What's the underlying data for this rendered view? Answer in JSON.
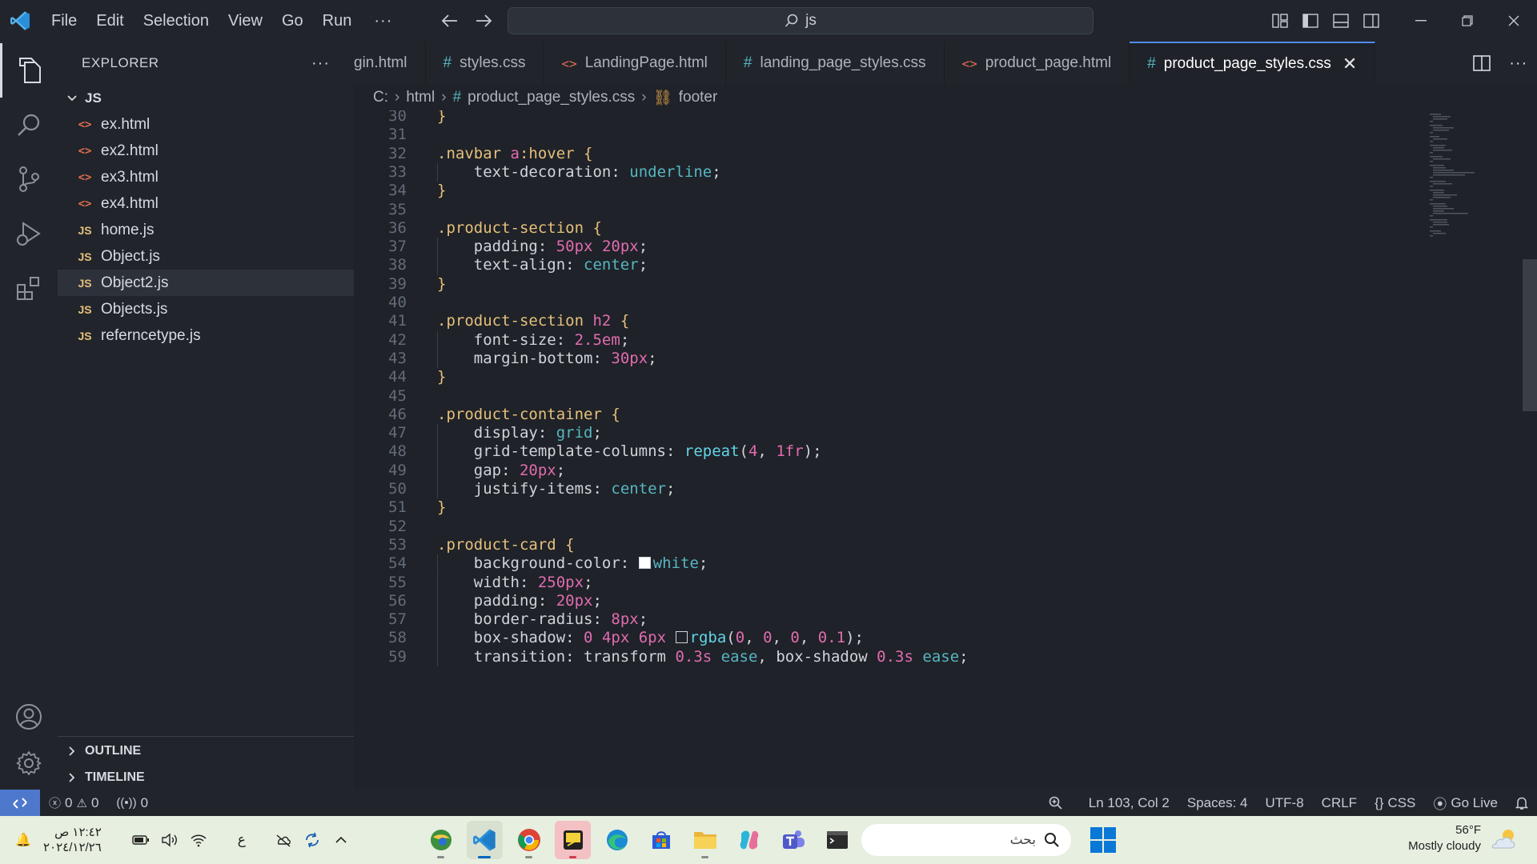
{
  "menu": [
    "File",
    "Edit",
    "Selection",
    "View",
    "Go",
    "Run"
  ],
  "menu_more": "···",
  "command_center": "js",
  "sidebar": {
    "title": "EXPLORER",
    "more": "···",
    "folder": "JS",
    "files": [
      {
        "name": "ex.html",
        "type": "html"
      },
      {
        "name": "ex2.html",
        "type": "html"
      },
      {
        "name": "ex3.html",
        "type": "html"
      },
      {
        "name": "ex4.html",
        "type": "html"
      },
      {
        "name": "home.js",
        "type": "js"
      },
      {
        "name": "Object.js",
        "type": "js"
      },
      {
        "name": "Object2.js",
        "type": "js",
        "selected": true
      },
      {
        "name": "Objects.js",
        "type": "js"
      },
      {
        "name": "referncetype.js",
        "type": "js"
      }
    ],
    "outline": "OUTLINE",
    "timeline": "TIMELINE"
  },
  "tabs": [
    {
      "label": "gin.html",
      "type": "html",
      "icon": ""
    },
    {
      "label": "styles.css",
      "type": "css",
      "icon": "#"
    },
    {
      "label": "LandingPage.html",
      "type": "html",
      "icon": "<>"
    },
    {
      "label": "landing_page_styles.css",
      "type": "css",
      "icon": "#"
    },
    {
      "label": "product_page.html",
      "type": "html",
      "icon": "<>"
    },
    {
      "label": "product_page_styles.css",
      "type": "css",
      "icon": "#",
      "active": true
    }
  ],
  "breadcrumb": {
    "drive": "C:",
    "folder": "html",
    "file": "product_page_styles.css",
    "symbol": "footer"
  },
  "code_lines": [
    {
      "n": "30",
      "tokens": [
        [
          "brace",
          "}"
        ]
      ]
    },
    {
      "n": "31",
      "tokens": []
    },
    {
      "n": "32",
      "tokens": [
        [
          "sel",
          ".navbar "
        ],
        [
          "el",
          "a"
        ],
        [
          "sel",
          ":hover "
        ],
        [
          "brace",
          "{"
        ]
      ]
    },
    {
      "n": "33",
      "tokens": [
        [
          "ind",
          ""
        ],
        [
          "prop",
          "text-decoration"
        ],
        [
          "pun",
          ": "
        ],
        [
          "val",
          "underline"
        ],
        [
          "pun",
          ";"
        ]
      ]
    },
    {
      "n": "34",
      "tokens": [
        [
          "brace",
          "}"
        ]
      ]
    },
    {
      "n": "35",
      "tokens": []
    },
    {
      "n": "36",
      "tokens": [
        [
          "sel",
          ".product-section "
        ],
        [
          "brace",
          "{"
        ]
      ]
    },
    {
      "n": "37",
      "tokens": [
        [
          "ind",
          ""
        ],
        [
          "prop",
          "padding"
        ],
        [
          "pun",
          ": "
        ],
        [
          "num",
          "50px"
        ],
        [
          "pun",
          " "
        ],
        [
          "num",
          "20px"
        ],
        [
          "pun",
          ";"
        ]
      ]
    },
    {
      "n": "38",
      "tokens": [
        [
          "ind",
          ""
        ],
        [
          "prop",
          "text-align"
        ],
        [
          "pun",
          ": "
        ],
        [
          "val",
          "center"
        ],
        [
          "pun",
          ";"
        ]
      ]
    },
    {
      "n": "39",
      "tokens": [
        [
          "brace",
          "}"
        ]
      ]
    },
    {
      "n": "40",
      "tokens": []
    },
    {
      "n": "41",
      "tokens": [
        [
          "sel",
          ".product-section "
        ],
        [
          "el",
          "h2"
        ],
        [
          "sel",
          " "
        ],
        [
          "brace",
          "{"
        ]
      ]
    },
    {
      "n": "42",
      "tokens": [
        [
          "ind",
          ""
        ],
        [
          "prop",
          "font-size"
        ],
        [
          "pun",
          ": "
        ],
        [
          "num",
          "2.5em"
        ],
        [
          "pun",
          ";"
        ]
      ]
    },
    {
      "n": "43",
      "tokens": [
        [
          "ind",
          ""
        ],
        [
          "prop",
          "margin-bottom"
        ],
        [
          "pun",
          ": "
        ],
        [
          "num",
          "30px"
        ],
        [
          "pun",
          ";"
        ]
      ]
    },
    {
      "n": "44",
      "tokens": [
        [
          "brace",
          "}"
        ]
      ]
    },
    {
      "n": "45",
      "tokens": []
    },
    {
      "n": "46",
      "tokens": [
        [
          "sel",
          ".product-container "
        ],
        [
          "brace",
          "{"
        ]
      ]
    },
    {
      "n": "47",
      "tokens": [
        [
          "ind",
          ""
        ],
        [
          "prop",
          "display"
        ],
        [
          "pun",
          ": "
        ],
        [
          "val",
          "grid"
        ],
        [
          "pun",
          ";"
        ]
      ]
    },
    {
      "n": "48",
      "tokens": [
        [
          "ind",
          ""
        ],
        [
          "prop",
          "grid-template-columns"
        ],
        [
          "pun",
          ": "
        ],
        [
          "fn",
          "repeat"
        ],
        [
          "pun",
          "("
        ],
        [
          "num",
          "4"
        ],
        [
          "pun",
          ", "
        ],
        [
          "num",
          "1fr"
        ],
        [
          "pun",
          ");"
        ]
      ]
    },
    {
      "n": "49",
      "tokens": [
        [
          "ind",
          ""
        ],
        [
          "prop",
          "gap"
        ],
        [
          "pun",
          ": "
        ],
        [
          "num",
          "20px"
        ],
        [
          "pun",
          ";"
        ]
      ]
    },
    {
      "n": "50",
      "tokens": [
        [
          "ind",
          ""
        ],
        [
          "prop",
          "justify-items"
        ],
        [
          "pun",
          ": "
        ],
        [
          "val",
          "center"
        ],
        [
          "pun",
          ";"
        ]
      ]
    },
    {
      "n": "51",
      "tokens": [
        [
          "brace",
          "}"
        ]
      ]
    },
    {
      "n": "52",
      "tokens": []
    },
    {
      "n": "53",
      "tokens": [
        [
          "sel",
          ".product-card "
        ],
        [
          "brace",
          "{"
        ]
      ]
    },
    {
      "n": "54",
      "tokens": [
        [
          "ind",
          ""
        ],
        [
          "prop",
          "background-color"
        ],
        [
          "pun",
          ": "
        ],
        [
          "swatch",
          "#ffffff"
        ],
        [
          "val",
          "white"
        ],
        [
          "pun",
          ";"
        ]
      ]
    },
    {
      "n": "55",
      "tokens": [
        [
          "ind",
          ""
        ],
        [
          "prop",
          "width"
        ],
        [
          "pun",
          ": "
        ],
        [
          "num",
          "250px"
        ],
        [
          "pun",
          ";"
        ]
      ]
    },
    {
      "n": "56",
      "tokens": [
        [
          "ind",
          ""
        ],
        [
          "prop",
          "padding"
        ],
        [
          "pun",
          ": "
        ],
        [
          "num",
          "20px"
        ],
        [
          "pun",
          ";"
        ]
      ]
    },
    {
      "n": "57",
      "tokens": [
        [
          "ind",
          ""
        ],
        [
          "prop",
          "border-radius"
        ],
        [
          "pun",
          ": "
        ],
        [
          "num",
          "8px"
        ],
        [
          "pun",
          ";"
        ]
      ]
    },
    {
      "n": "58",
      "tokens": [
        [
          "ind",
          ""
        ],
        [
          "prop",
          "box-shadow"
        ],
        [
          "pun",
          ": "
        ],
        [
          "num",
          "0"
        ],
        [
          "pun",
          " "
        ],
        [
          "num",
          "4px"
        ],
        [
          "pun",
          " "
        ],
        [
          "num",
          "6px"
        ],
        [
          "pun",
          " "
        ],
        [
          "swatch",
          "rgba(0,0,0,0.1)"
        ],
        [
          "fn",
          "rgba"
        ],
        [
          "pun",
          "("
        ],
        [
          "num",
          "0"
        ],
        [
          "pun",
          ", "
        ],
        [
          "num",
          "0"
        ],
        [
          "pun",
          ", "
        ],
        [
          "num",
          "0"
        ],
        [
          "pun",
          ", "
        ],
        [
          "num",
          "0.1"
        ],
        [
          "pun",
          ");"
        ]
      ]
    },
    {
      "n": "59",
      "tokens": [
        [
          "ind",
          ""
        ],
        [
          "prop",
          "transition"
        ],
        [
          "pun",
          ": "
        ],
        [
          "prop",
          "transform "
        ],
        [
          "num",
          "0.3s"
        ],
        [
          "pun",
          " "
        ],
        [
          "val",
          "ease"
        ],
        [
          "pun",
          ", "
        ],
        [
          "prop",
          "box-shadow "
        ],
        [
          "num",
          "0.3s"
        ],
        [
          "pun",
          " "
        ],
        [
          "val",
          "ease"
        ],
        [
          "pun",
          ";"
        ]
      ]
    }
  ],
  "status": {
    "errors": "0",
    "warnings": "0",
    "ports": "0",
    "position": "Ln 103, Col 2",
    "spaces": "Spaces: 4",
    "encoding": "UTF-8",
    "eol": "CRLF",
    "language": "CSS",
    "golive": "Go Live"
  },
  "taskbar": {
    "time": "١٢:٤٢ ص",
    "date": "٢٠٢٤/١٢/٢٦",
    "lang": "ع",
    "search": "بحث",
    "temp": "56°F",
    "weather": "Mostly cloudy"
  },
  "colors": {
    "accent": "#528bff",
    "remote": "#4d78cc",
    "selector": "#e5c07b",
    "value": "#56b6c2",
    "number": "#e06cb0"
  }
}
